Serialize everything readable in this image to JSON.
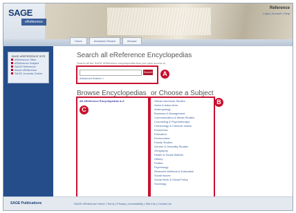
{
  "header": {
    "logo_text": "SAGE",
    "logo_sub": "eReference",
    "right_title": "Reference",
    "right_links": "Login | Account | Help",
    "tabs": [
      "Home",
      "Advanced Search",
      "Browse"
    ]
  },
  "sidebar": {
    "heading": "SAGE eREFERENCE SITE",
    "items": [
      "eReference Titles",
      "eReference Subject",
      "SAGE Reference",
      "About eReference",
      "SAGE Journals Online"
    ]
  },
  "search": {
    "title": "Search all eReference Encyclopedias",
    "description": "Search all the SAGE eReference encyclopedias that you have access to",
    "button": "Search",
    "advanced": "Advanced Search >"
  },
  "browse": {
    "title": "Browse Encyclopedias",
    "link": "All eReference Encyclopedias A-Z"
  },
  "subjects": {
    "title": "or Choose a Subject",
    "items": [
      "African American Studies",
      "Asian & Asian Area",
      "Anthropology",
      "Business & Management",
      "Communication & Media Studies",
      "Counseling & Psychotherapy",
      "Criminology & Criminal Justice",
      "Economics",
      "Education",
      "Environment",
      "Family Studies",
      "Gender & Sexuality Studies",
      "Geography",
      "Health & Social Welfare",
      "History",
      "Politics",
      "Psychology",
      "Research Methods & Evaluation",
      "Social Issues",
      "Social Work & Social Policy",
      "Sociology"
    ]
  },
  "annotations": {
    "a": "A",
    "b": "B",
    "c": "C"
  },
  "footer": {
    "logo": "SAGE Publications",
    "links": "SAGE eReference Home | Terms | Privacy | Accessibility | Site Info | Contact Us"
  }
}
